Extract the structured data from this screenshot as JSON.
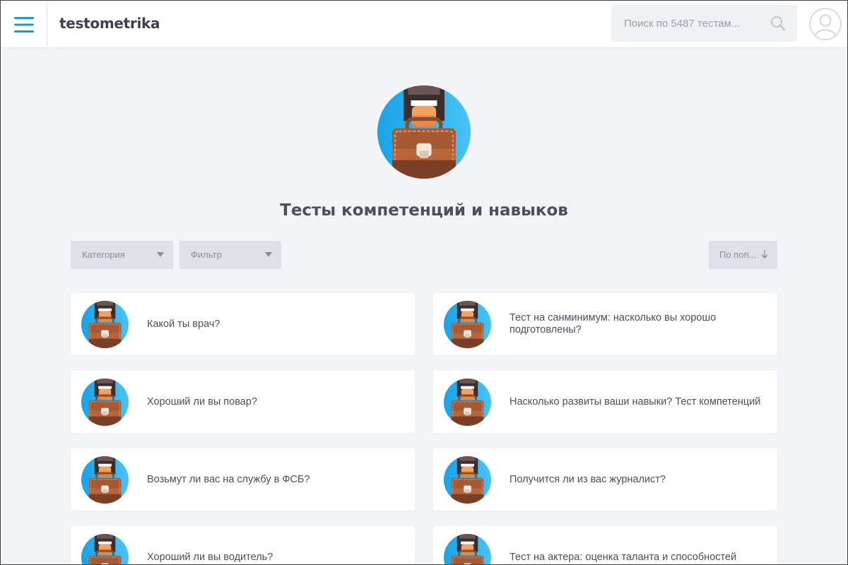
{
  "header": {
    "logo": "testometrika",
    "search_placeholder": "Поиск по 5487 тестам..."
  },
  "page": {
    "title": "Тесты компетенций и навыков"
  },
  "filters": {
    "category_label": "Категория",
    "filter_label": "Фильтр",
    "sort_label": "По поп..."
  },
  "tests": [
    {
      "title": "Какой ты врач?"
    },
    {
      "title": "Тест на санминимум: насколько вы хорошо подготовлены?"
    },
    {
      "title": "Хороший ли вы повар?"
    },
    {
      "title": "Насколько развиты ваши навыки? Тест компетенций"
    },
    {
      "title": "Возьмут ли вас на службу в ФСБ?"
    },
    {
      "title": "Получится ли из вас журналист?"
    },
    {
      "title": "Хороший ли вы водитель?"
    },
    {
      "title": "Тест на актера: оценка таланта и способностей"
    }
  ],
  "colors": {
    "accent": "#1a9ad8",
    "background": "#f3f4f7",
    "select_bg": "#dee1e7",
    "title_text": "#4c4f60"
  },
  "icons": {
    "menu": "hamburger-icon",
    "search": "search-icon",
    "avatar": "user-avatar-icon",
    "category": "briefcase-hand-icon"
  }
}
